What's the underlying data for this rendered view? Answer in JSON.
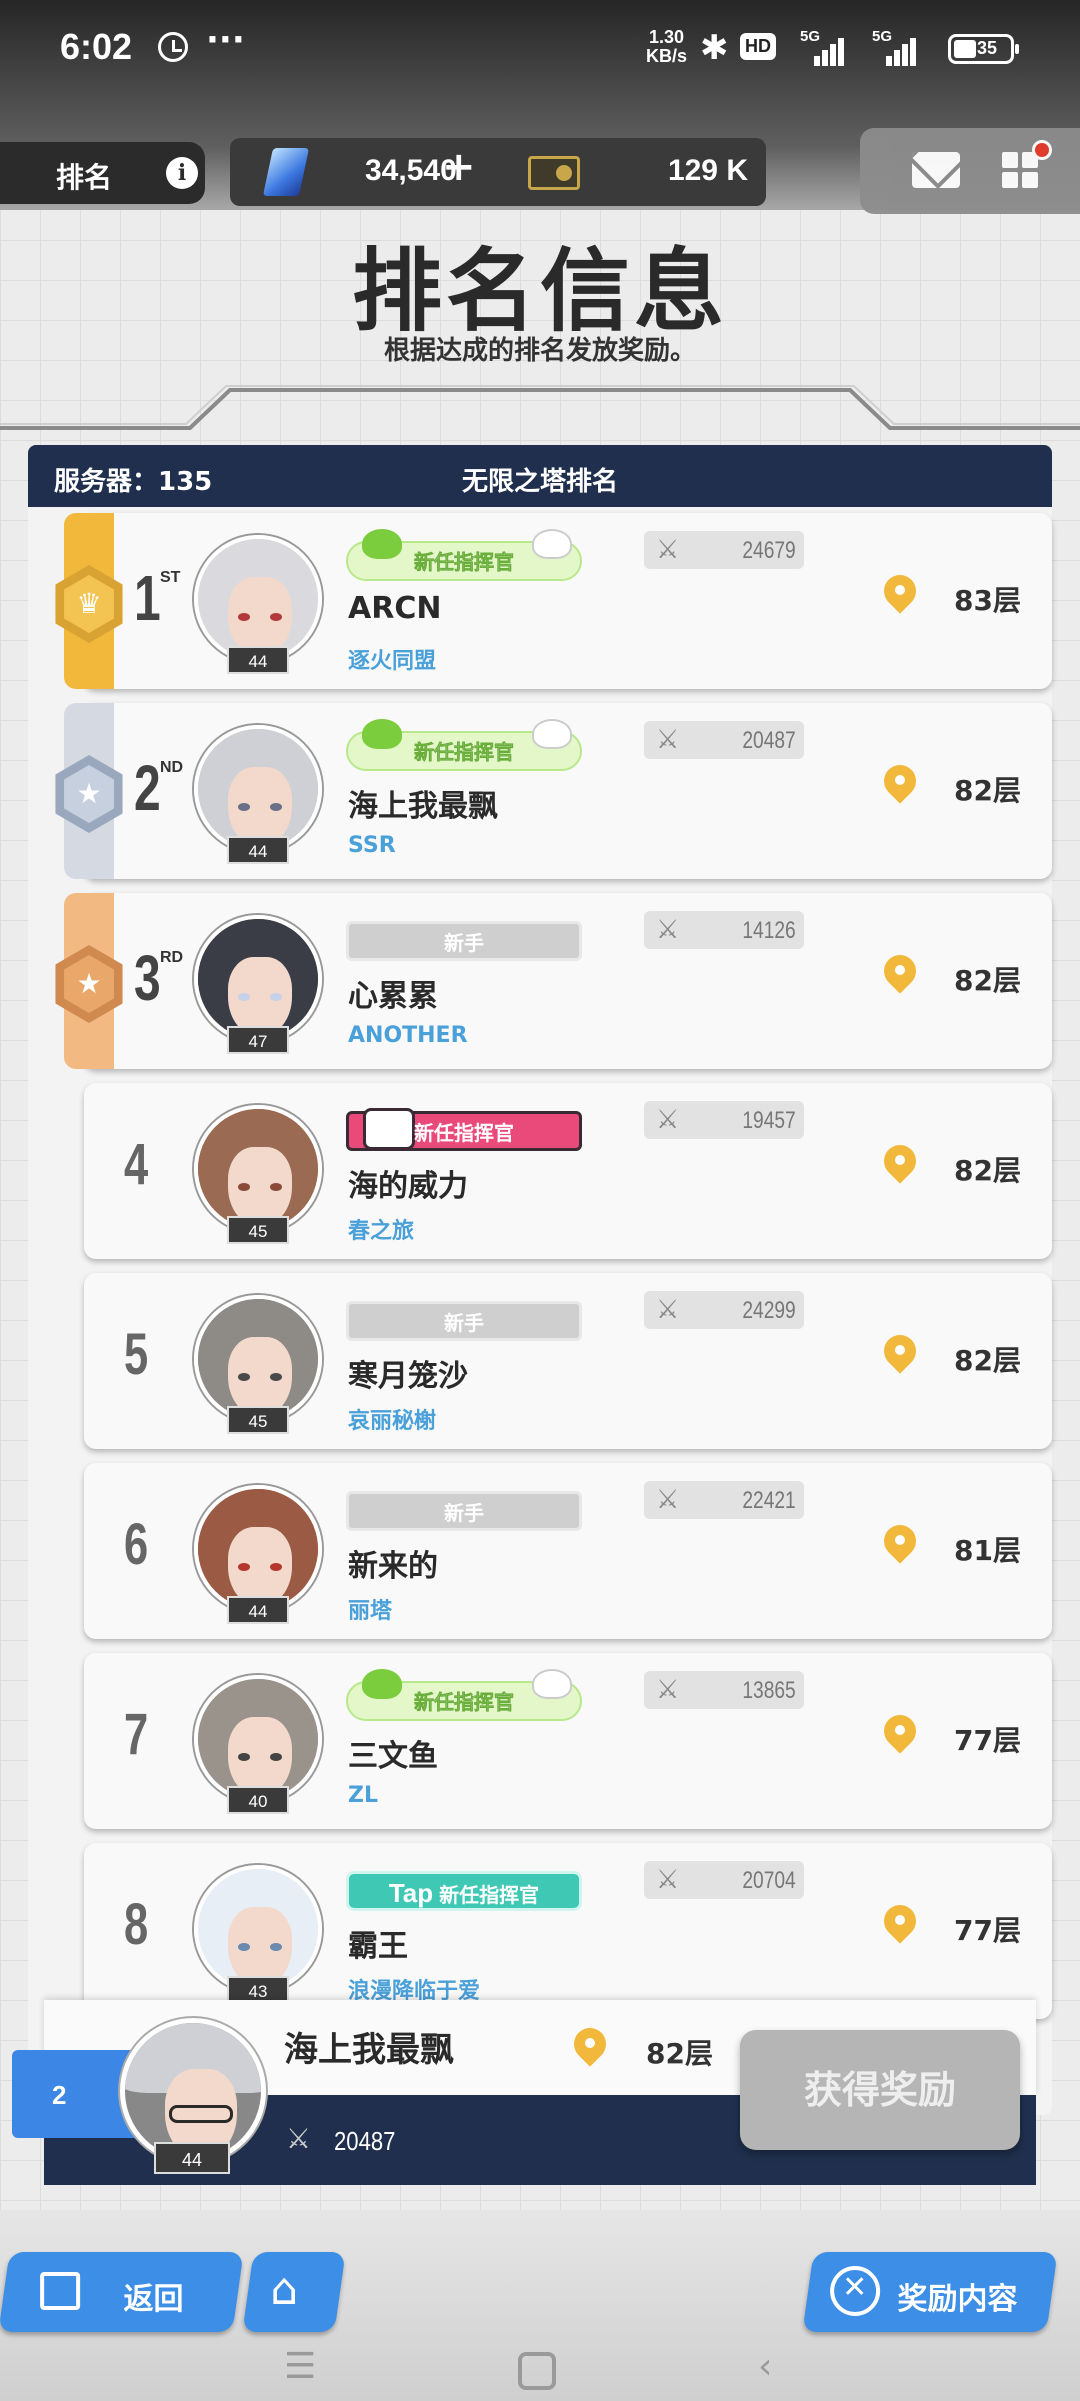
{
  "status_bar": {
    "time": "6:02",
    "more": "···",
    "net_speed_value": "1.30",
    "net_speed_unit": "KB/s",
    "hd": "HD",
    "sig1": "5G",
    "sig2": "5G",
    "battery": "35"
  },
  "top_bar": {
    "tab_label": "排名",
    "info": "i",
    "gems": "34,540",
    "gems_plus": "+",
    "credits": "129 K"
  },
  "header": {
    "title": "排名信息",
    "subtitle": "根据达成的排名发放奖励。"
  },
  "board": {
    "server": "服务器：135",
    "title": "无限之塔排名"
  },
  "rows": [
    {
      "rank": "1",
      "suffix": "ST",
      "name": "ARCN",
      "union": "逐火同盟",
      "level": "44",
      "power": "24679",
      "floor": "83层",
      "badge": "新任指挥官",
      "badge_style": "green",
      "medal": "gold",
      "hair": "#d9d9de",
      "eye": "#b23a3a"
    },
    {
      "rank": "2",
      "suffix": "ND",
      "name": "海上我最飘",
      "union": "SSR",
      "level": "44",
      "power": "20487",
      "floor": "82层",
      "badge": "新任指挥官",
      "badge_style": "green",
      "medal": "silver",
      "hair": "#cfcfd6",
      "eye": "#6b6f8a"
    },
    {
      "rank": "3",
      "suffix": "RD",
      "name": "心累累",
      "union": "ANOTHER",
      "level": "47",
      "power": "14126",
      "floor": "82层",
      "badge": "新手",
      "badge_style": "gray",
      "medal": "bronze",
      "hair": "#3a3d46",
      "eye": "#c7d2ea"
    },
    {
      "rank": "4",
      "suffix": "",
      "name": "海的威力",
      "union": "春之旅",
      "level": "45",
      "power": "19457",
      "floor": "82层",
      "badge": "新任指挥官",
      "badge_style": "pink",
      "medal": "",
      "hair": "#9b6a52",
      "eye": "#8a4a3a"
    },
    {
      "rank": "5",
      "suffix": "",
      "name": "寒月笼沙",
      "union": "哀丽秘榭",
      "level": "45",
      "power": "24299",
      "floor": "82层",
      "badge": "新手",
      "badge_style": "gray",
      "medal": "",
      "hair": "#8e8a86",
      "eye": "#4a4a4a"
    },
    {
      "rank": "6",
      "suffix": "",
      "name": "新来的",
      "union": "丽塔",
      "level": "44",
      "power": "22421",
      "floor": "81层",
      "badge": "新手",
      "badge_style": "gray",
      "medal": "",
      "hair": "#9a5a44",
      "eye": "#b3362f"
    },
    {
      "rank": "7",
      "suffix": "",
      "name": "三文鱼",
      "union": "ZL",
      "level": "40",
      "power": "13865",
      "floor": "77层",
      "badge": "新任指挥官",
      "badge_style": "green",
      "medal": "",
      "hair": "#9a938c",
      "eye": "#444"
    },
    {
      "rank": "8",
      "suffix": "",
      "name": "霸王",
      "union": "浪漫降临于爱",
      "level": "43",
      "power": "20704",
      "floor": "77层",
      "badge": "新任指挥官",
      "badge_style": "teal",
      "badge_prefix": "Tap",
      "medal": "",
      "hair": "#e8eef5",
      "eye": "#6a8ab0"
    }
  ],
  "my_rank": {
    "rank": "2",
    "name": "海上我最飘",
    "floor": "82层",
    "power": "20487",
    "level": "44",
    "claim_label": "获得奖励"
  },
  "bottom_nav": {
    "back_label": "返回",
    "reward_label": "奖励内容"
  },
  "colors": {
    "navy": "#1f2f4d",
    "blue_button": "#3c8ee6",
    "gold": "#f2b83b",
    "union_blue": "#4aa0d8"
  }
}
